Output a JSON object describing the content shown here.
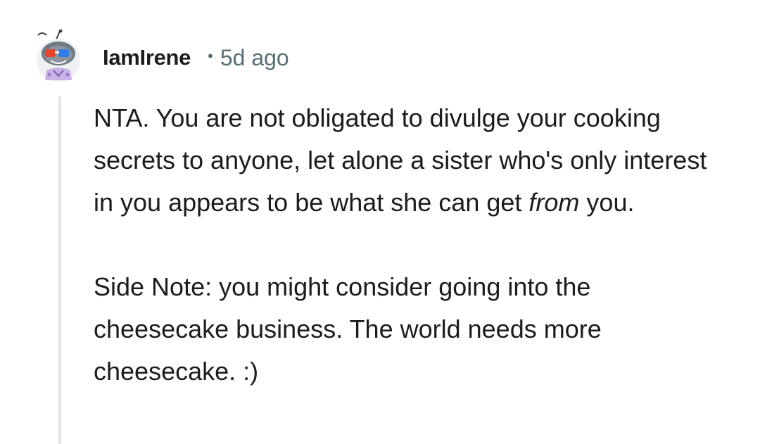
{
  "comment": {
    "username": "IamIrene",
    "separator": "•",
    "timestamp": "5d ago",
    "body": {
      "p1_before": "NTA. You are not obligated to divulge your cooking secrets to anyone, let alone a sister who's only interest in you appears to be what she can get ",
      "p1_emphasis": "from",
      "p1_after": " you.",
      "p2": "Side Note: you might consider going into the cheesecake business. The world needs more cheesecake. :)"
    }
  },
  "icons": {
    "avatar": "snoo-avatar-icon"
  },
  "colors": {
    "text": "#1c1c1c",
    "meta": "#576f76",
    "thread_line": "#e2e6e8"
  }
}
